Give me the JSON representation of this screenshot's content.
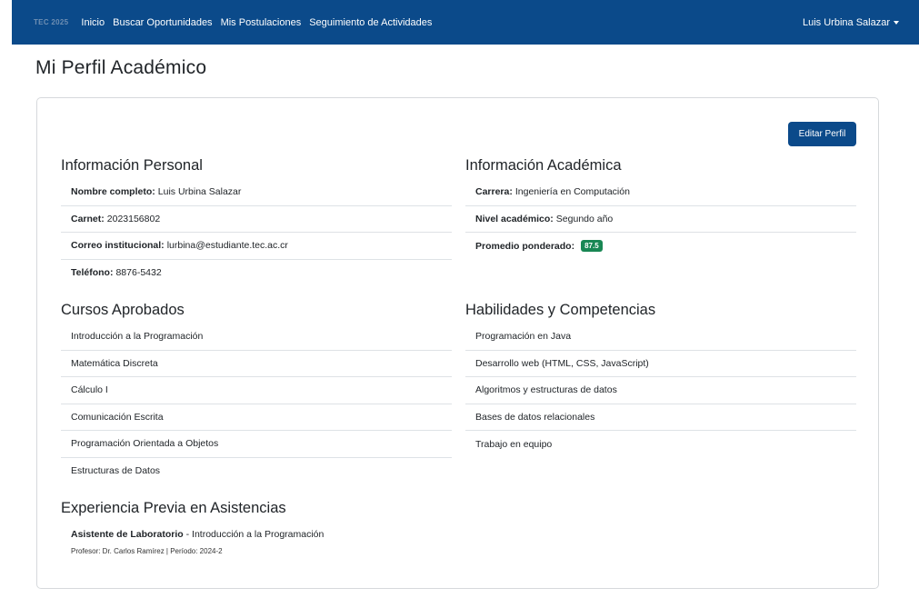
{
  "navbar": {
    "brand": "TEC 2025",
    "links": [
      "Inicio",
      "Buscar Oportunidades",
      "Mis Postulaciones",
      "Seguimiento de Actividades"
    ],
    "user": "Luis Urbina Salazar"
  },
  "page": {
    "title": "Mi Perfil Académico"
  },
  "actions": {
    "edit_label": "Editar Perfil"
  },
  "personal": {
    "title": "Información Personal",
    "fields": [
      {
        "label": "Nombre completo:",
        "value": "Luis Urbina Salazar"
      },
      {
        "label": "Carnet:",
        "value": "2023156802"
      },
      {
        "label": "Correo institucional:",
        "value": "lurbina@estudiante.tec.ac.cr"
      },
      {
        "label": "Teléfono:",
        "value": "8876-5432"
      }
    ]
  },
  "academic": {
    "title": "Información Académica",
    "fields": [
      {
        "label": "Carrera:",
        "value": "Ingeniería en Computación"
      },
      {
        "label": "Nivel académico:",
        "value": "Segundo año"
      }
    ],
    "average_label": "Promedio ponderado:",
    "average_value": "87.5",
    "average_color": "#198754"
  },
  "courses": {
    "title": "Cursos Aprobados",
    "items": [
      "Introducción a la Programación",
      "Matemática Discreta",
      "Cálculo I",
      "Comunicación Escrita",
      "Programación Orientada a Objetos",
      "Estructuras de Datos"
    ]
  },
  "skills": {
    "title": "Habilidades y Competencias",
    "items": [
      "Programación en Java",
      "Desarrollo web (HTML, CSS, JavaScript)",
      "Algoritmos y estructuras de datos",
      "Bases de datos relacionales",
      "Trabajo en equipo"
    ]
  },
  "experience": {
    "title": "Experiencia Previa en Asistencias",
    "role": "Asistente de Laboratorio",
    "course": " - Introducción a la Programación",
    "details": "Profesor: Dr. Carlos Ramírez | Período: 2024-2"
  },
  "colors": {
    "primary": "#0b4a8a",
    "success": "#198754"
  }
}
